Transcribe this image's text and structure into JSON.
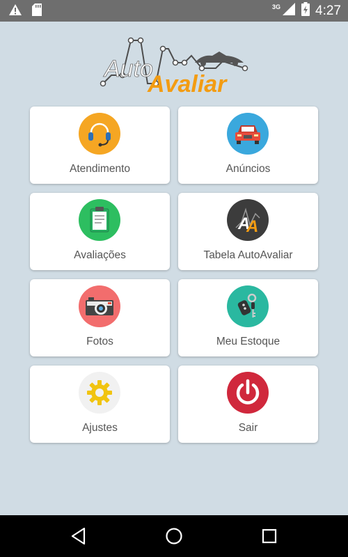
{
  "status_bar": {
    "network_type": "3G",
    "time": "4:27",
    "icons": [
      "warning-icon",
      "sd-card-icon",
      "signal-icon",
      "battery-charging-icon"
    ]
  },
  "logo": {
    "line1": "Auto",
    "line2": "Avaliar",
    "brand_orange": "#f39c12"
  },
  "menu": {
    "items": [
      {
        "label": "Atendimento",
        "icon": "headset-icon",
        "color": "#f5a623"
      },
      {
        "label": "Anúncios",
        "icon": "car-icon",
        "color": "#3aa8dd"
      },
      {
        "label": "Avaliações",
        "icon": "clipboard-icon",
        "color": "#2dbe60"
      },
      {
        "label": "Tabela AutoAvaliar",
        "icon": "autoavaliar-logo-icon",
        "color": "#3c3c3c"
      },
      {
        "label": "Fotos",
        "icon": "camera-icon",
        "color": "#f26d6d"
      },
      {
        "label": "Meu Estoque",
        "icon": "car-keys-icon",
        "color": "#2ab8a0"
      },
      {
        "label": "Ajustes",
        "icon": "gear-icon",
        "color": "#f1f1f1"
      },
      {
        "label": "Sair",
        "icon": "power-icon",
        "color": "#d0283c"
      }
    ]
  },
  "nav_bar": {
    "buttons": [
      "back-icon",
      "home-icon",
      "recents-icon"
    ]
  }
}
